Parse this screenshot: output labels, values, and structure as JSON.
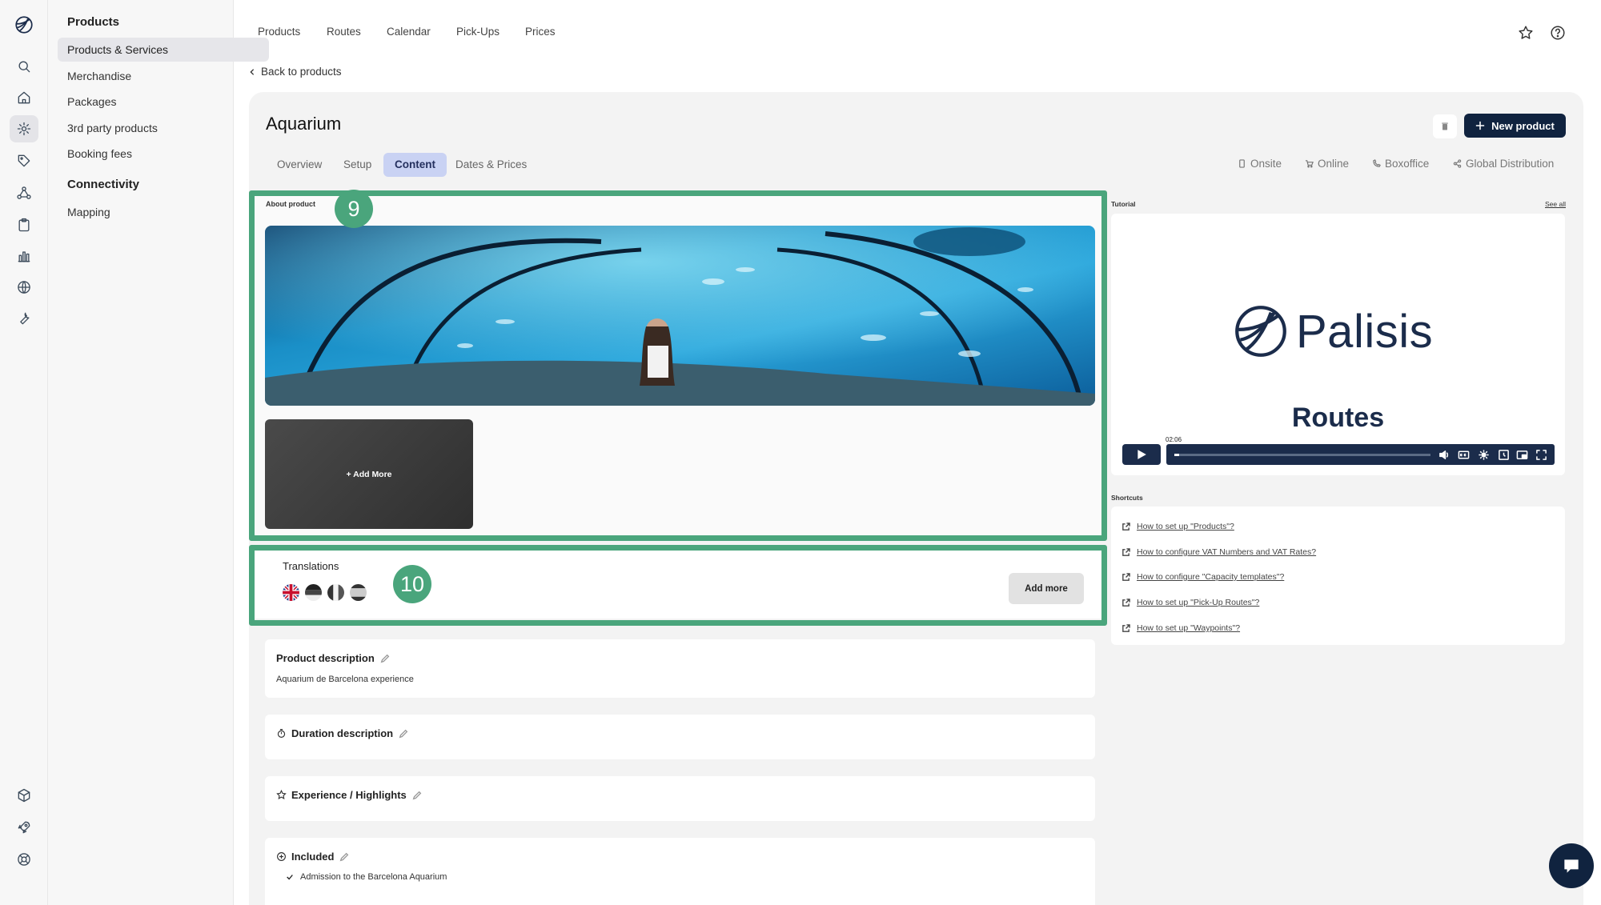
{
  "sidebar": {
    "rail_icons": [
      "palisis-logo-icon",
      "search-icon",
      "home-icon",
      "gear-icon",
      "tag-icon",
      "network-icon",
      "clipboard-icon",
      "bar-chart-icon",
      "globe-icon",
      "wrench-icon",
      "cube-icon",
      "rocket-icon",
      "lifebuoy-icon"
    ],
    "active_rail_icon": "gear-icon",
    "sections": [
      {
        "heading": "Products",
        "items": [
          "Products & Services",
          "Merchandise",
          "Packages",
          "3rd party products",
          "Booking fees"
        ]
      },
      {
        "heading": "Connectivity",
        "items": [
          "Mapping"
        ]
      }
    ],
    "active_item": "Products & Services"
  },
  "top_tabs": [
    "Products",
    "Routes",
    "Calendar",
    "Pick-Ups",
    "Prices"
  ],
  "top_icons": [
    "star-icon",
    "help-icon"
  ],
  "back_link": "Back to products",
  "product": {
    "title": "Aquarium",
    "new_button": "New product",
    "tabs": [
      "Overview",
      "Setup",
      "Content",
      "Dates & Prices"
    ],
    "active_tab": "Content",
    "channels": [
      "Onsite",
      "Online",
      "Boxoffice",
      "Global Distribution"
    ]
  },
  "about": {
    "label": "About product",
    "add_more": "+ Add More",
    "badge": "9"
  },
  "translations": {
    "title": "Translations",
    "flags": [
      "flag-uk-icon",
      "flag-de-icon",
      "flag-fr-icon",
      "flag-es-icon"
    ],
    "add_button": "Add more",
    "badge": "10"
  },
  "cards": {
    "description": {
      "title": "Product description",
      "text": "Aquarium de Barcelona experience"
    },
    "duration": {
      "title": "Duration description"
    },
    "highlights": {
      "title": "Experience / Highlights"
    },
    "included": {
      "title": "Included",
      "items": [
        "Admission to the Barcelona Aquarium"
      ]
    }
  },
  "tutorial": {
    "label": "Tutorial",
    "see_all": "See all",
    "logo_text": "Palisis",
    "video_title": "Routes",
    "timecode": "02:06",
    "progress": 0.02
  },
  "shortcuts": {
    "label": "Shortcuts",
    "links": [
      "How to set up \"Products\"?",
      "How to configure VAT Numbers and VAT Rates?",
      "How to configure \"Capacity templates\"?",
      "How to set up \"Pick-Up Routes\"?",
      "How to set up \"Waypoints\"?"
    ]
  },
  "colors": {
    "brand_navy": "#10233f",
    "highlight_green": "#4aa57c",
    "active_tab_bg": "#c9d2f3"
  }
}
